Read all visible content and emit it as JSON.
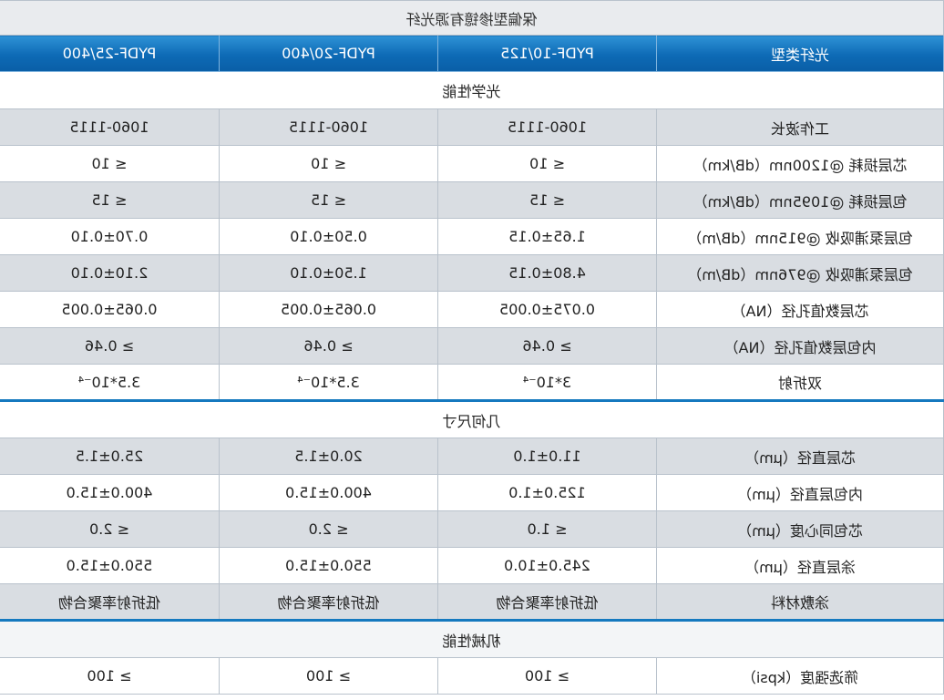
{
  "title": "保偏型掺镱有源光纤",
  "header": [
    "光纤类型",
    "PYDF-10/125",
    "PYDF-20/400",
    "PYDF-25/400"
  ],
  "sections": [
    {
      "name": "光学性能",
      "rows": [
        [
          "工作波长",
          "1060-1115",
          "1060-1115",
          "1060-1115"
        ],
        [
          "芯层损耗 @1200nm（dB/km）",
          "≤ 10",
          "≤ 10",
          "≤ 10"
        ],
        [
          "包层损耗 @1095nm（dB/km）",
          "≤ 15",
          "≤ 15",
          "≤ 15"
        ],
        [
          "包层泵浦吸收 @915nm（dB/m）",
          "1.65±0.15",
          "0.50±0.10",
          "0.70±0.10"
        ],
        [
          "包层泵浦吸收 @976nm（dB/m）",
          "4.80±0.15",
          "1.50±0.10",
          "2.10±0.10"
        ],
        [
          "芯层数值孔径（NA）",
          "0.075±0.005",
          "0.065±0.005",
          "0.065±0.005"
        ],
        [
          "内包层数值孔径（NA）",
          "≥ 0.46",
          "≥ 0.46",
          "≥ 0.46"
        ],
        [
          "双折射",
          "3*10⁻⁴",
          "3.5*10⁻⁴",
          "3.5*10⁻⁴"
        ]
      ]
    },
    {
      "name": "几何尺寸",
      "rows": [
        [
          "芯层直径（μm）",
          "11.0±1.0",
          "20.0±1.5",
          "25.0±1.5"
        ],
        [
          "内包层直径（μm）",
          "125.0±1.0",
          "400.0±15.0",
          "400.0±15.0"
        ],
        [
          "芯包同心度（μm）",
          "≤ 1.0",
          "≤ 2.0",
          "≤ 2.0"
        ],
        [
          "涂层直径（μm）",
          "245.0±10.0",
          "550.0±15.0",
          "550.0±15.0"
        ],
        [
          "涂敷材料",
          "低折射率聚合物",
          "低折射率聚合物",
          "低折射率聚合物"
        ]
      ]
    },
    {
      "name": "机械性能",
      "rows": [
        [
          "筛选强度（kpsi）",
          "≥ 100",
          "≥ 100",
          "≥ 100"
        ]
      ]
    }
  ],
  "colors": {
    "header_top": "#2e92d6",
    "header_bottom": "#0a5ea6",
    "section_rule": "#1579bf",
    "row_shaded": "#d9dde2",
    "title_bg": "#e9ebee"
  }
}
